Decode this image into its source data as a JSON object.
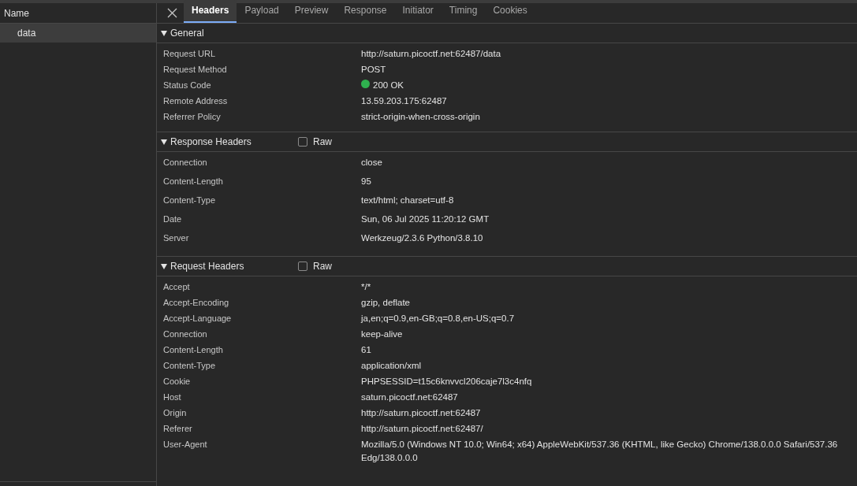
{
  "sidebar": {
    "header": "Name",
    "items": [
      {
        "label": "data",
        "selected": true
      }
    ]
  },
  "tabs": [
    {
      "label": "Headers",
      "selected": true
    },
    {
      "label": "Payload",
      "selected": false
    },
    {
      "label": "Preview",
      "selected": false
    },
    {
      "label": "Response",
      "selected": false
    },
    {
      "label": "Initiator",
      "selected": false
    },
    {
      "label": "Timing",
      "selected": false
    },
    {
      "label": "Cookies",
      "selected": false
    }
  ],
  "sections": [
    {
      "title": "General",
      "expanded": true,
      "rows": [
        {
          "name": "Request URL",
          "value": "http://saturn.picoctf.net:62487/data"
        },
        {
          "name": "Request Method",
          "value": "POST"
        },
        {
          "name": "Status Code",
          "value": "200 OK",
          "color": "#2fb14f"
        },
        {
          "name": "Remote Address",
          "value": "13.59.203.175:62487"
        },
        {
          "name": "Referrer Policy",
          "value": "strict-origin-when-cross-origin"
        }
      ]
    },
    {
      "title": "Response Headers",
      "expanded": true,
      "raw": {
        "label": "Raw",
        "checked": false
      },
      "rows": [
        {
          "name": "Connection",
          "value": "close"
        },
        {
          "name": "Content-Length",
          "value": "95"
        },
        {
          "name": "Content-Type",
          "value": "text/html; charset=utf-8"
        },
        {
          "name": "Date",
          "value": "Sun, 06 Jul 2025 11:20:12 GMT"
        },
        {
          "name": "Server",
          "value": "Werkzeug/2.3.6 Python/3.8.10"
        }
      ]
    },
    {
      "title": "Request Headers",
      "expanded": true,
      "raw": {
        "label": "Raw",
        "checked": false
      },
      "rows": [
        {
          "name": "Accept",
          "value": "*/*"
        },
        {
          "name": "Accept-Encoding",
          "value": "gzip, deflate"
        },
        {
          "name": "Accept-Language",
          "value": "ja,en;q=0.9,en-GB;q=0.8,en-US;q=0.7"
        },
        {
          "name": "Connection",
          "value": "keep-alive"
        },
        {
          "name": "Content-Length",
          "value": "61"
        },
        {
          "name": "Content-Type",
          "value": "application/xml"
        },
        {
          "name": "Cookie",
          "value": "PHPSESSID=t15c6knvvcl206caje7l3c4nfq"
        },
        {
          "name": "Host",
          "value": "saturn.picoctf.net:62487"
        },
        {
          "name": "Origin",
          "value": "http://saturn.picoctf.net:62487"
        },
        {
          "name": "Referer",
          "value": "http://saturn.picoctf.net:62487/"
        },
        {
          "name": "User-Agent",
          "value": "Mozilla/5.0 (Windows NT 10.0; Win64; x64) AppleWebKit/537.36 (KHTML, like Gecko) Chrome/138.0.0.0 Safari/537.36 Edg/138.0.0.0"
        }
      ]
    }
  ]
}
